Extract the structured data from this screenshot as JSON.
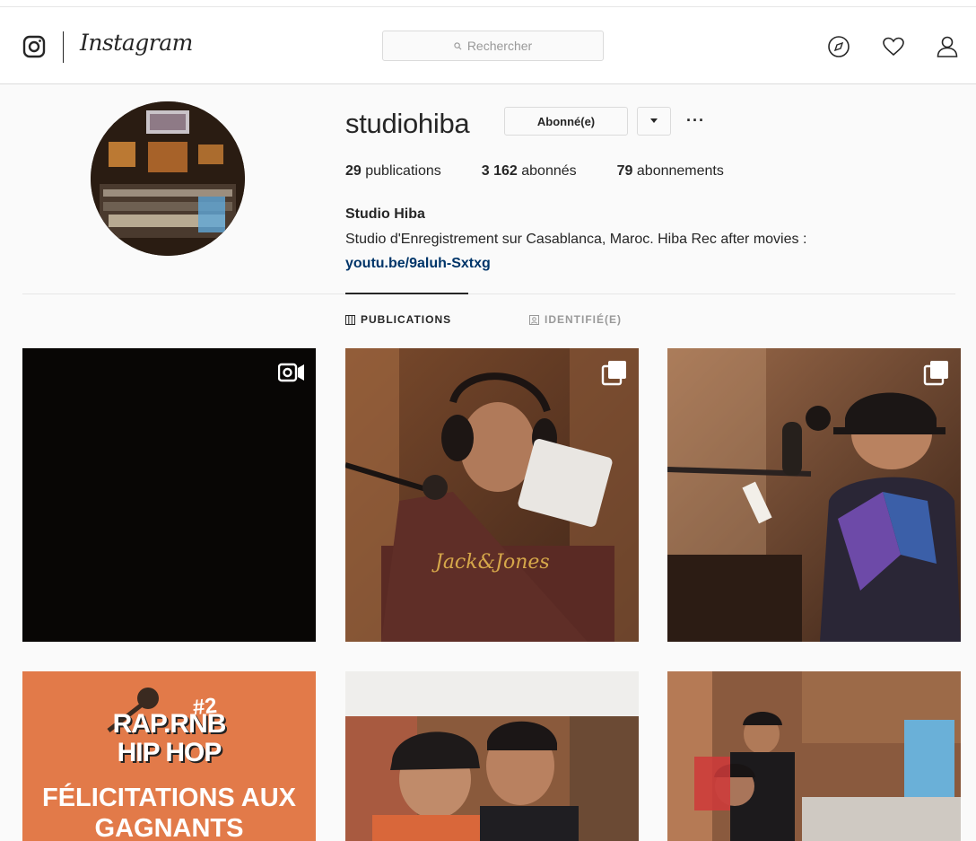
{
  "navbar": {
    "wordmark": "Instagram",
    "search_placeholder": "Rechercher",
    "icons": [
      "instagram-camera-icon",
      "explore-compass-icon",
      "heart-icon",
      "user-icon"
    ]
  },
  "profile": {
    "username": "studiohiba",
    "follow_button": "Abonné(e)",
    "more_button": "···",
    "stats": [
      {
        "value": "29",
        "label": "publications"
      },
      {
        "value": "3 162",
        "label": "abonnés"
      },
      {
        "value": "79",
        "label": "abonnements"
      }
    ],
    "full_name": "Studio Hiba",
    "bio": "Studio d'Enregistrement sur Casablanca, Maroc. Hiba Rec after movies :",
    "link": "youtu.be/9aluh-Sxtxg"
  },
  "tabs": [
    {
      "label": "PUBLICATIONS",
      "active": true,
      "icon": "grid-icon"
    },
    {
      "label": "IDENTIFIÉ(E)",
      "active": false,
      "icon": "tagged-icon"
    }
  ],
  "posts": {
    "row1": [
      "video",
      "carousel",
      "carousel"
    ],
    "promo": {
      "line1": "RAP.RNB",
      "line2": "HIP HOP",
      "number": "#2",
      "line3": "FÉLICITATIONS AUX",
      "line4": "GAGNANTS"
    }
  },
  "colors": {
    "link": "#003569",
    "border": "#dbdbdb",
    "background": "#fafafa",
    "promo_orange": "#e27a49"
  }
}
